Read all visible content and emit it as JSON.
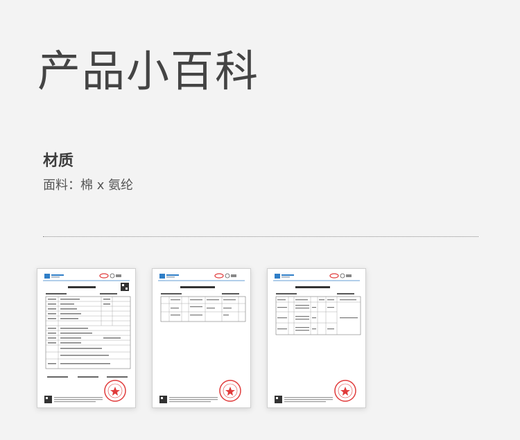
{
  "page": {
    "title": "产品小百科"
  },
  "material": {
    "heading": "材质",
    "body": "面料：棉 x 氨纶"
  },
  "documents": [
    {
      "icon": "test-report-page-1-icon"
    },
    {
      "icon": "test-report-page-2-icon"
    },
    {
      "icon": "test-report-page-3-icon"
    }
  ],
  "colors": {
    "background": "#f3f3f3",
    "title": "#444444",
    "stamp": "#e03a3a",
    "logo": "#2f7ec7"
  }
}
